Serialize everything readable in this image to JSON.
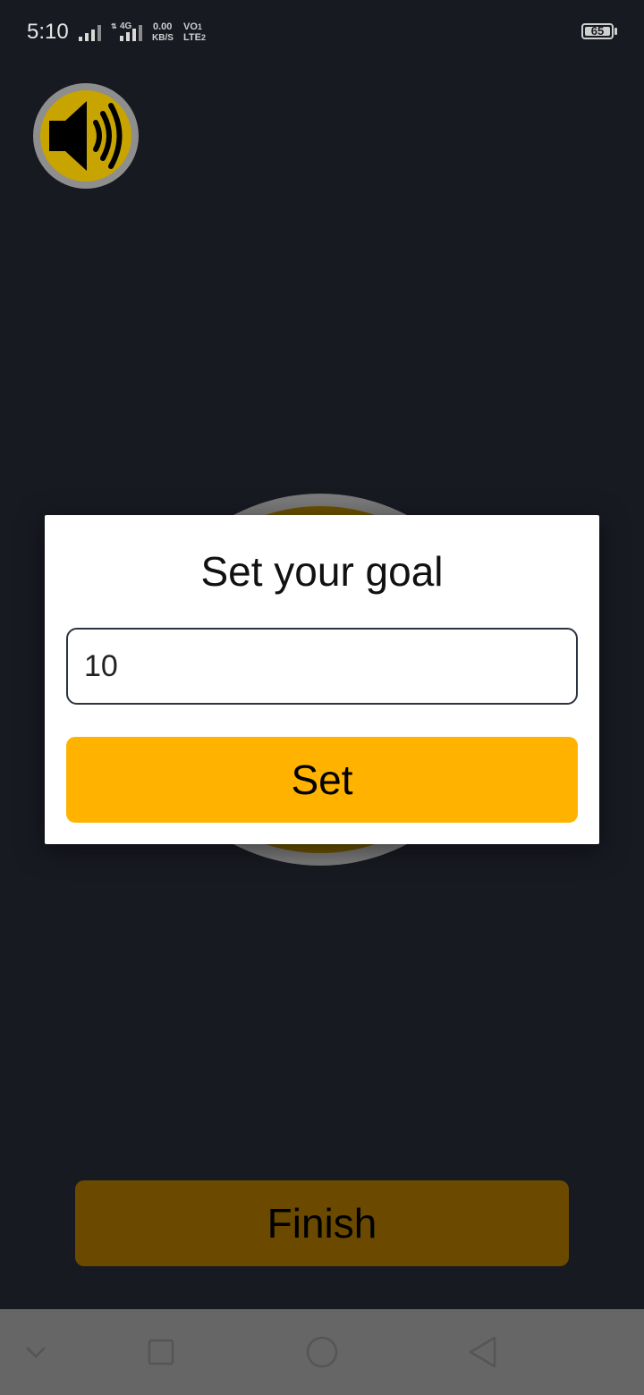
{
  "status_bar": {
    "time": "5:10",
    "network_type": "4G",
    "data_rate_value": "0.00",
    "data_rate_unit": "KB/S",
    "volte_top": "VO",
    "volte_bottom": "LTE",
    "sim_top": "1",
    "sim_bottom": "2",
    "battery_level": "65"
  },
  "speaker": {
    "icon": "speaker-volume-icon"
  },
  "dialog": {
    "title": "Set your goal",
    "goal_value": "10",
    "set_label": "Set"
  },
  "finish_label": "Finish",
  "nav": {
    "icons": [
      "chevron-down-icon",
      "recents-square-icon",
      "home-circle-icon",
      "back-triangle-icon"
    ]
  },
  "colors": {
    "background": "#181a22",
    "accent": "#ffb300",
    "finish_dimmed": "#6b4a00"
  }
}
